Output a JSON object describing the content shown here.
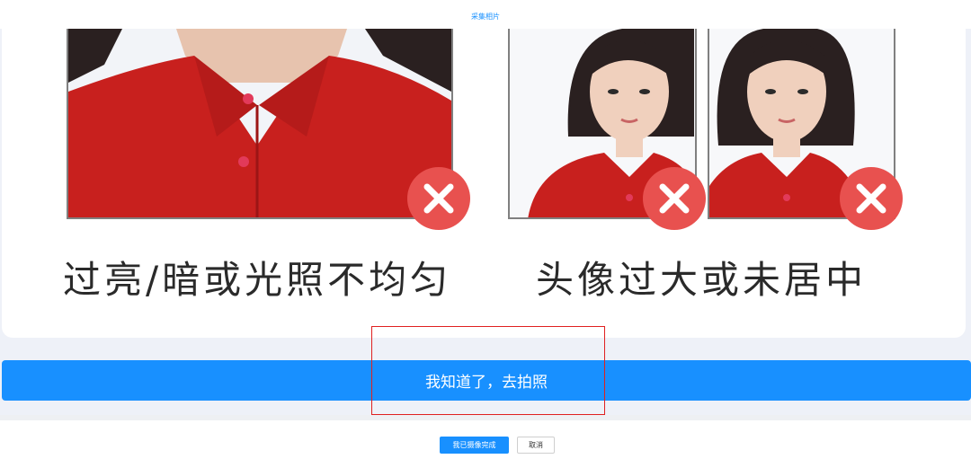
{
  "header": {
    "title": "采集相片"
  },
  "examples": {
    "left_caption": "过亮/暗或光照不均匀",
    "right_caption": "头像过大或未居中"
  },
  "actions": {
    "confirm_label": "我知道了，去拍照",
    "done_label": "我已摄像完成",
    "cancel_label": "取消"
  },
  "colors": {
    "accent": "#1890ff",
    "error_mark": "#e8514f",
    "highlight_border": "#e02020",
    "shirt_red": "#c8201e"
  },
  "icons": [
    "close-icon"
  ]
}
